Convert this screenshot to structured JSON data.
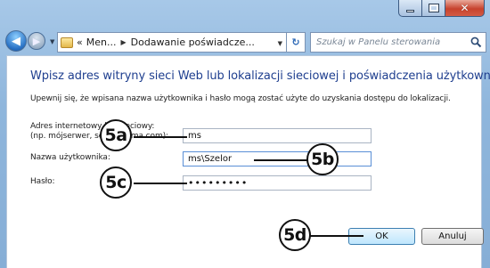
{
  "window": {
    "min_glyph": "",
    "max_glyph": "",
    "close_glyph": "✕"
  },
  "addressbar": {
    "crumb_prefix": "«",
    "crumbs": [
      "Men...",
      "Dodawanie poświadcze..."
    ],
    "refresh_glyph": "↻",
    "search_placeholder": "Szukaj w Panelu sterowania"
  },
  "dialog": {
    "heading": "Wpisz adres witryny sieci Web lub lokalizacji sieciowej i poświadczenia użytkownika",
    "subtext": "Upewnij się, że wpisana nazwa użytkownika i hasło mogą zostać użyte do uzyskania dostępu do lokalizacji.",
    "address_label_line1": "Adres internetowy lub sieciowy:",
    "address_label_line2": "(np. mójserwer, serwer.firma.com):",
    "address_value": "ms",
    "username_label": "Nazwa użytkownika:",
    "username_value": "ms\\Szelor",
    "password_label": "Hasło:",
    "password_value": "•••••••••",
    "ok_label": "OK",
    "cancel_label": "Anuluj"
  },
  "callouts": [
    "5a",
    "5b",
    "5c",
    "5d"
  ],
  "colors": {
    "heading": "#1f3f8f",
    "frame": "#8fb6dc",
    "close_button": "#c7422d"
  },
  "icons": {
    "back": "back-arrow-icon",
    "forward": "forward-arrow-icon",
    "folder": "control-panel-icon",
    "refresh": "refresh-icon",
    "search": "search-icon"
  }
}
